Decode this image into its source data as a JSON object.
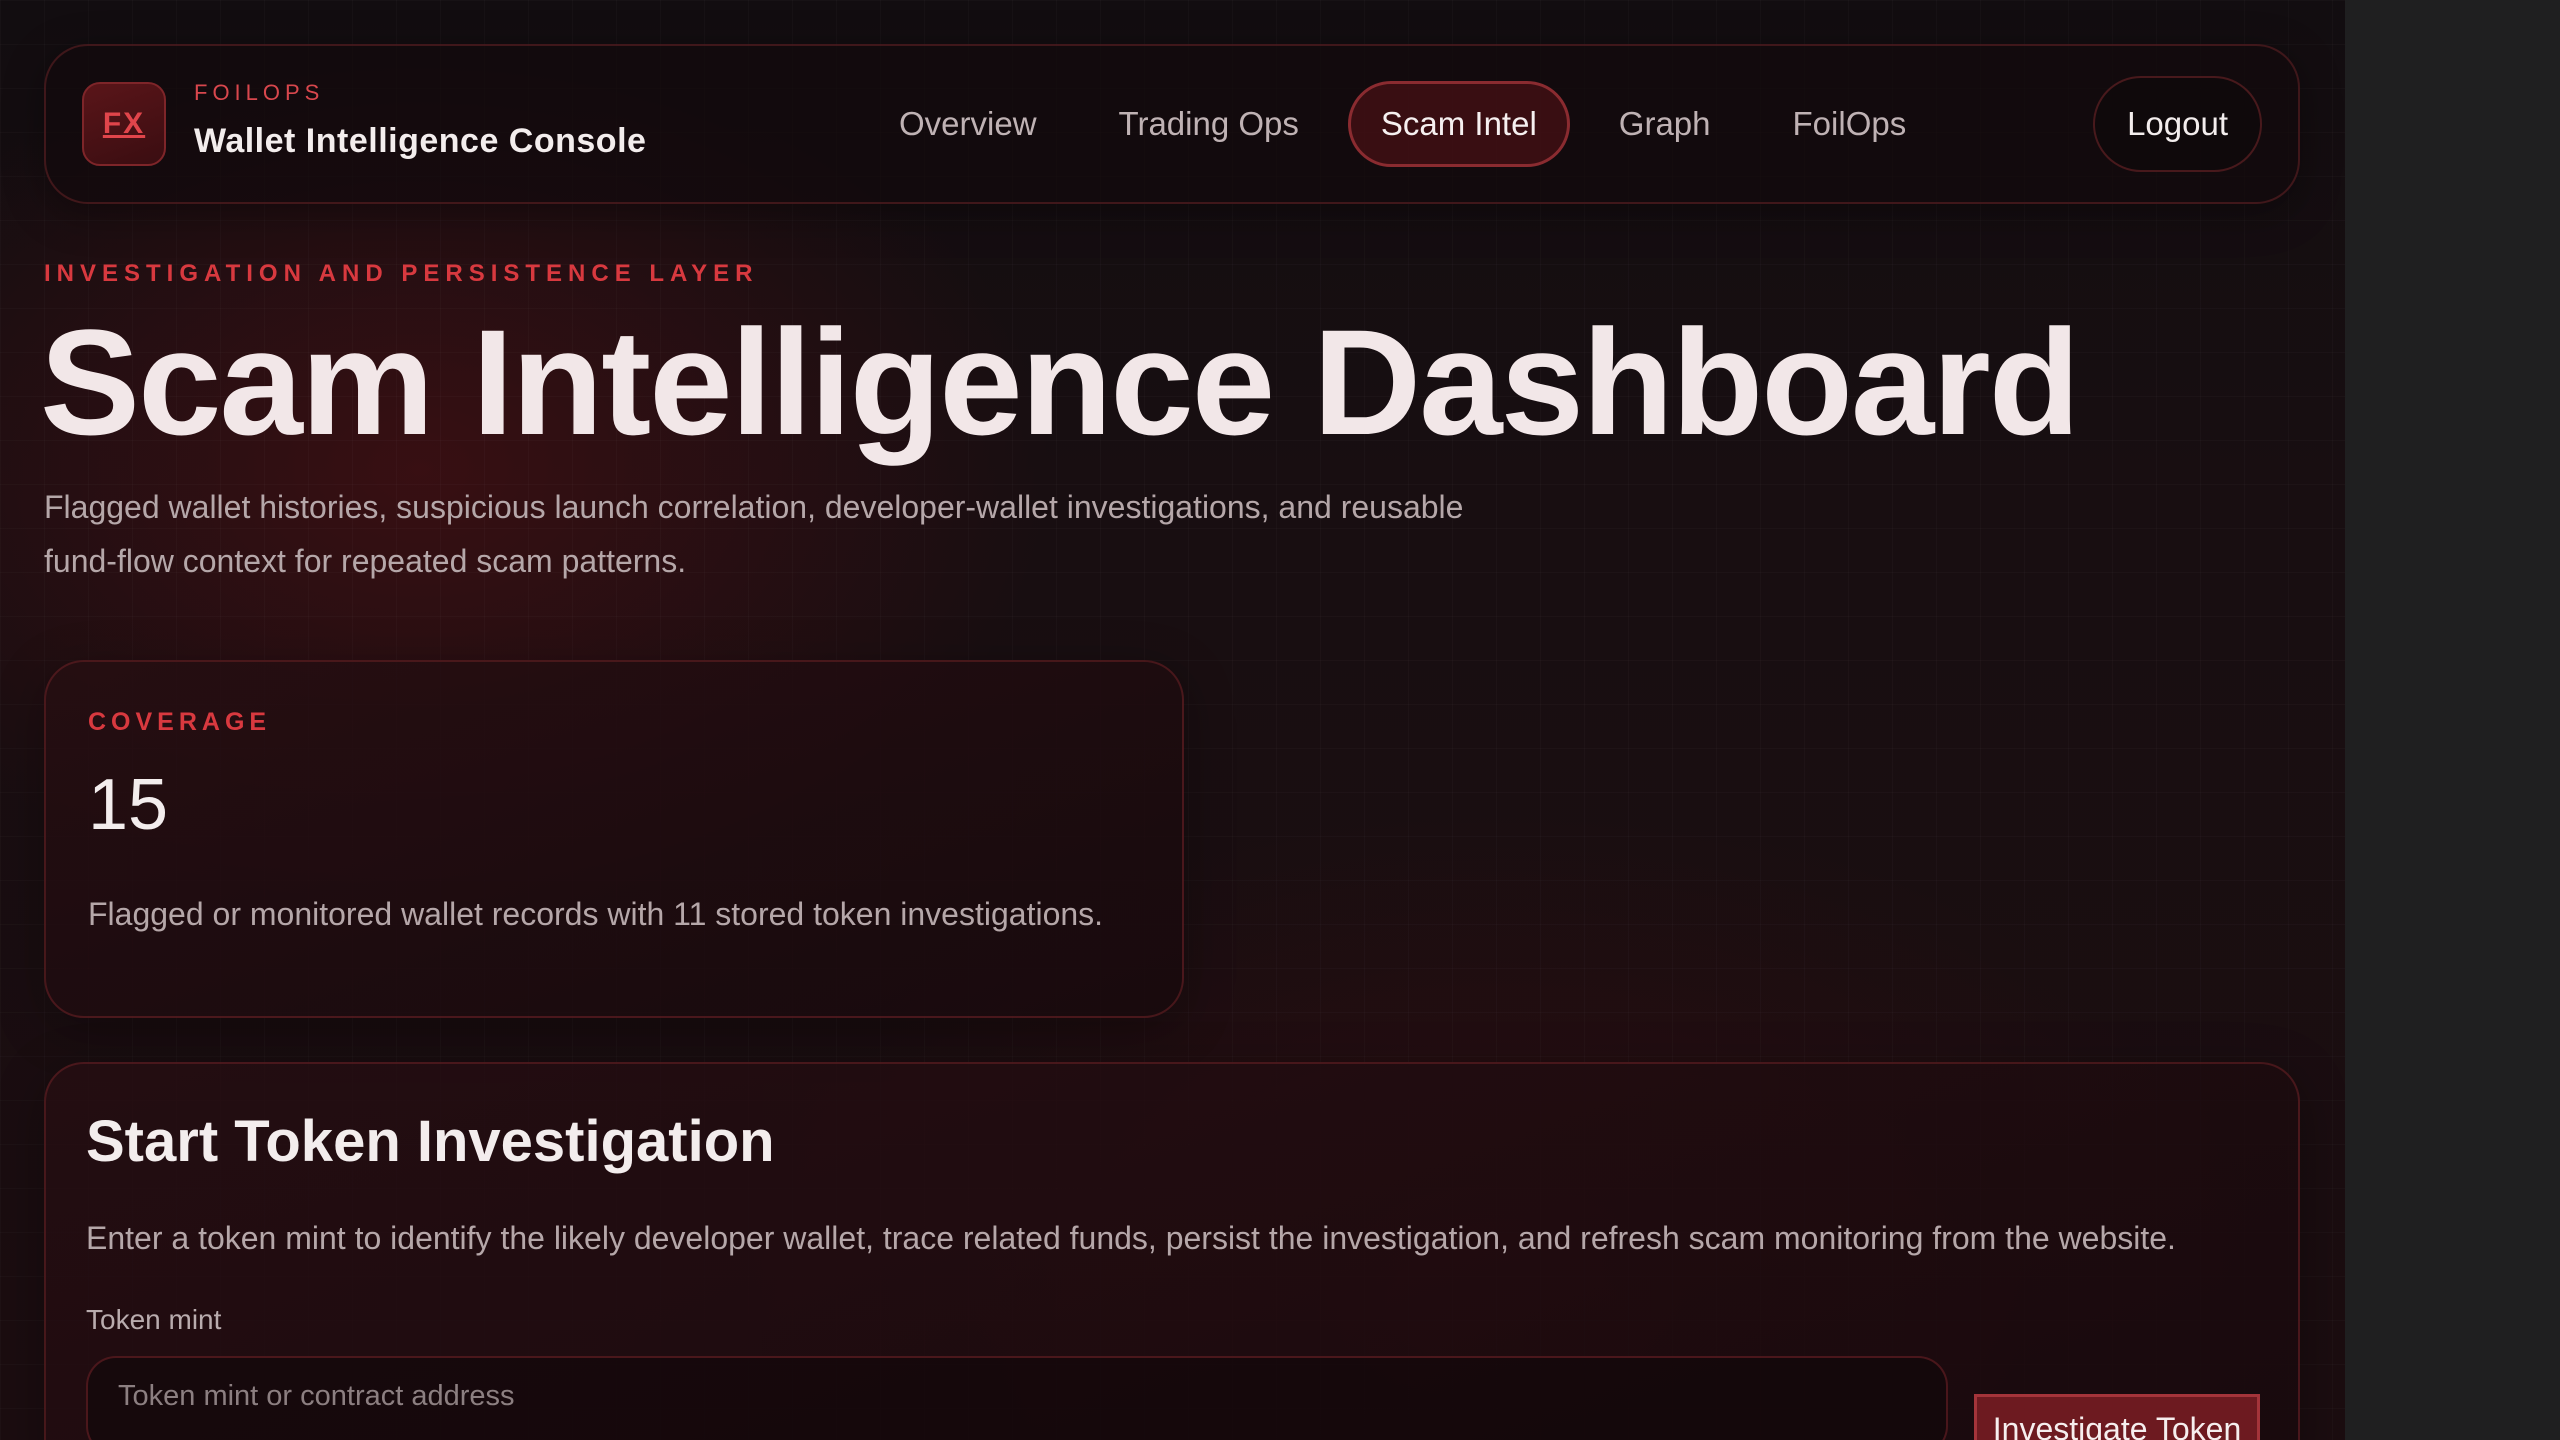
{
  "brand": {
    "mark": "FX",
    "kicker": "FOILOPS",
    "title": "Wallet Intelligence Console"
  },
  "nav": {
    "items": [
      {
        "label": "Overview",
        "active": false
      },
      {
        "label": "Trading Ops",
        "active": false
      },
      {
        "label": "Scam Intel",
        "active": true
      },
      {
        "label": "Graph",
        "active": false
      },
      {
        "label": "FoilOps",
        "active": false
      }
    ],
    "logout_label": "Logout"
  },
  "hero": {
    "eyebrow": "INVESTIGATION AND PERSISTENCE LAYER",
    "title": "Scam Intelligence Dashboard",
    "subtitle": "Flagged wallet histories, suspicious launch correlation, developer-wallet investigations, and reusable fund-flow context for repeated scam patterns."
  },
  "coverage": {
    "label": "COVERAGE",
    "value": "15",
    "description": "Flagged or monitored wallet records with 11 stored token investigations."
  },
  "investigation": {
    "title": "Start Token Investigation",
    "description": "Enter a token mint to identify the likely developer wallet, trace related funds, persist the investigation, and refresh scam monitoring from the website.",
    "field_label": "Token mint",
    "input_value": "",
    "input_placeholder": "Token mint or contract address",
    "button_label": "Investigate Token"
  },
  "colors": {
    "accent": "#d8393f",
    "background": "#150d10",
    "button": "#6d1a20"
  }
}
